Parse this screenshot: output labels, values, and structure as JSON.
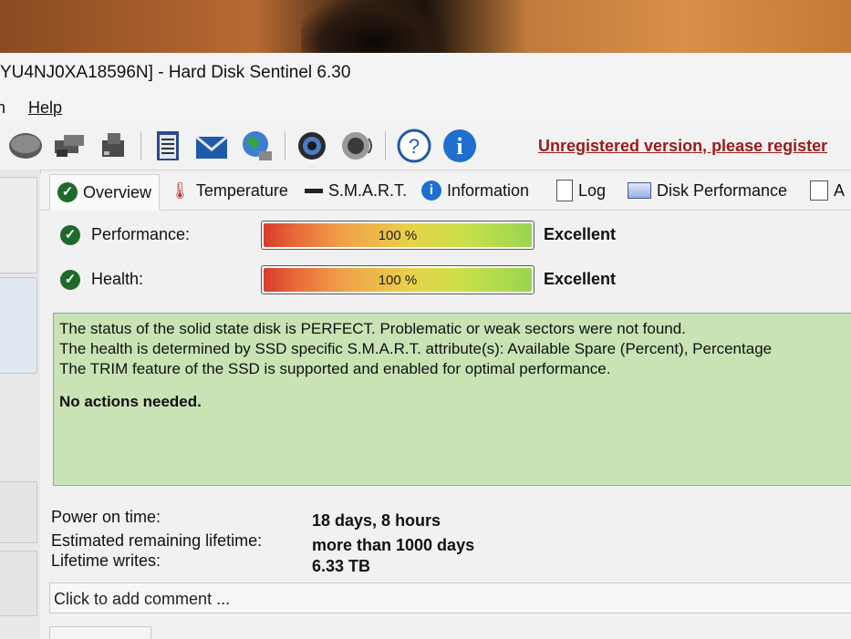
{
  "window": {
    "title": "YU4NJ0XA18596N]  -  Hard Disk Sentinel 6.30"
  },
  "menu": {
    "partial_item": "n",
    "help": "Help"
  },
  "toolbar": {
    "icons": [
      "drive-icon",
      "drive-check-icon",
      "drive-status-icon",
      "report-icon",
      "mail-icon",
      "network-globe-icon",
      "settings-gear-icon",
      "sound-speaker-icon",
      "help-icon",
      "info-icon"
    ],
    "unregistered_notice": "Unregistered version, please register"
  },
  "tabs": [
    {
      "label": "Overview"
    },
    {
      "label": "Temperature"
    },
    {
      "label": "S.M.A.R.T."
    },
    {
      "label": "Information"
    },
    {
      "label": "Log"
    },
    {
      "label": "Disk Performance"
    },
    {
      "label": "A"
    }
  ],
  "metrics": {
    "performance": {
      "label": "Performance:",
      "percent": 100,
      "percent_text": "100 %",
      "rating": "Excellent"
    },
    "health": {
      "label": "Health:",
      "percent": 100,
      "percent_text": "100 %",
      "rating": "Excellent"
    }
  },
  "status": {
    "line1": "The status of the solid state disk is PERFECT. Problematic or weak sectors were not found.",
    "line2": "The health is determined by SSD specific S.M.A.R.T. attribute(s):  Available Spare (Percent), Percentage",
    "line3": "The TRIM feature of the SSD is supported and enabled for optimal performance.",
    "action": "No actions needed."
  },
  "info": {
    "power_on_label": "Power on time:",
    "power_on_value": "18 days, 8 hours",
    "lifetime_label": "Estimated remaining lifetime:",
    "lifetime_value": "more than 1000 days",
    "writes_label": "Lifetime writes:",
    "writes_value": "6.33 TB"
  },
  "comment": {
    "placeholder": "Click to add comment ..."
  },
  "colors": {
    "status_bg": "#c9e3b4",
    "check_green": "#1f6a2a",
    "unregistered_red": "#9c1818"
  }
}
